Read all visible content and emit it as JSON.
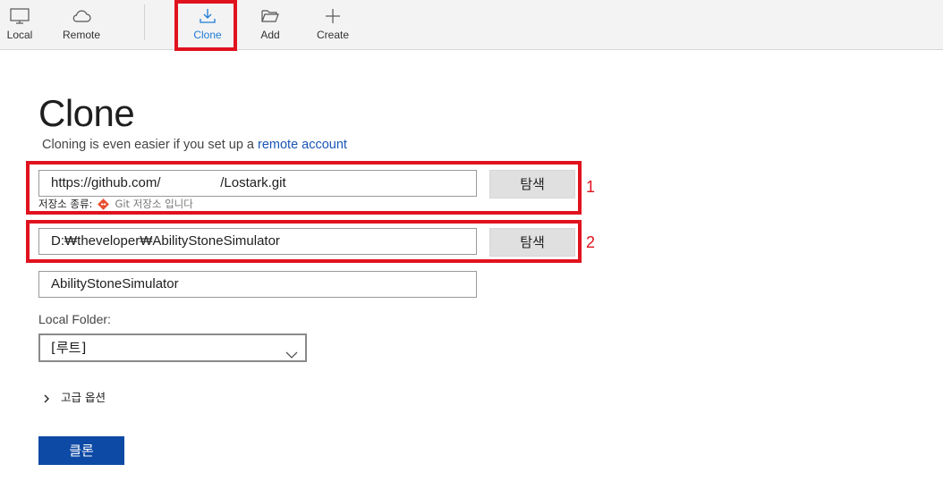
{
  "toolbar": {
    "items": [
      {
        "label": "Local",
        "icon": "monitor-icon"
      },
      {
        "label": "Remote",
        "icon": "cloud-icon"
      },
      {
        "label": "Clone",
        "icon": "download-icon",
        "active": true
      },
      {
        "label": "Add",
        "icon": "folder-open-icon"
      },
      {
        "label": "Create",
        "icon": "plus-icon"
      }
    ]
  },
  "page": {
    "title": "Clone",
    "subtitle_prefix": "Cloning is even easier if you set up a ",
    "subtitle_link": "remote account"
  },
  "form": {
    "url_value": "https://github.com/                /Lostark.git",
    "browse_label_1": "탐색",
    "repo_type_label": "저장소 종류:",
    "repo_type_value": "Git 저장소 입니다",
    "path_value": "D:₩theveloper₩AbilityStoneSimulator",
    "browse_label_2": "탐색",
    "name_value": "AbilityStoneSimulator",
    "local_folder_label": "Local Folder:",
    "local_folder_selected": "[루트]",
    "advanced_label": "고급 옵션",
    "submit_label": "클론"
  },
  "annotations": {
    "box1_number": "1",
    "box2_number": "2"
  },
  "colors": {
    "accent": "#1e7bd6",
    "primary_button": "#0d4aa6",
    "annotation_red": "#e0121e",
    "link": "#1a55b5"
  }
}
